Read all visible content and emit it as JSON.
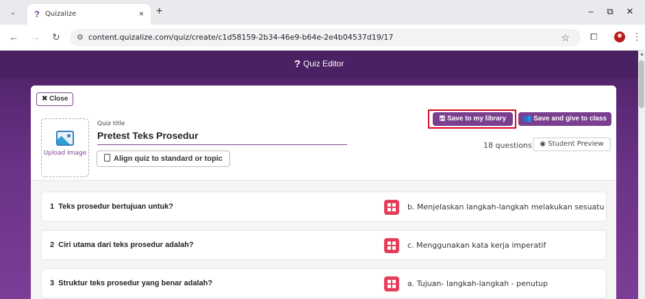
{
  "browser": {
    "tab_title": "Quizalize",
    "tab_close": "×",
    "new_tab": "+",
    "url": "content.quizalize.com/quiz/create/c1d58159-2b34-46e9-b64e-2e4b04537d19/17"
  },
  "app": {
    "header_title": "Quiz Editor",
    "close_label": "Close",
    "upload_label": "Upload Image",
    "quiz_title_label": "Quiz title",
    "quiz_title": "Pretest Teks Prosedur",
    "align_label": "Align quiz to standard or topic",
    "save_library_label": "Save to my library",
    "save_give_label": "Save and give to class",
    "question_count": "18 questions",
    "student_preview_label": "Student Preview"
  },
  "questions": [
    {
      "number": "1",
      "text": "Teks prosedur bertujuan untuk?",
      "answer": "b. Menjelaskan langkah-langkah melakukan sesuatu"
    },
    {
      "number": "2",
      "text": "Ciri utama dari teks prosedur adalah?",
      "answer": "c. Menggunakan kata kerja imperatif"
    },
    {
      "number": "3",
      "text": "Struktur teks prosedur yang benar adalah?",
      "answer": "a. Tujuan- langkah-langkah - penutup"
    }
  ],
  "colors": {
    "brand": "#7b3f8f",
    "header": "#4a2162",
    "badge": "#e53e5a",
    "highlight": "#e0001b"
  }
}
